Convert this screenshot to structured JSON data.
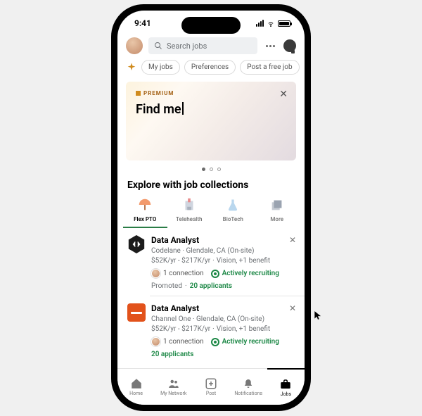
{
  "statusbar": {
    "time": "9:41"
  },
  "topbar": {
    "search_placeholder": "Search jobs"
  },
  "chips_row": {
    "items": [
      {
        "label": "My jobs"
      },
      {
        "label": "Preferences"
      },
      {
        "label": "Post a free job"
      }
    ]
  },
  "banner": {
    "badge": "PREMIUM",
    "typed_text": "Find me"
  },
  "explore": {
    "heading": "Explore with job collections",
    "categories": [
      {
        "label": "Flex PTO",
        "icon": "umbrella-icon",
        "active": true
      },
      {
        "label": "Telehealth",
        "icon": "hospital-icon",
        "active": false
      },
      {
        "label": "BioTech",
        "icon": "flask-icon",
        "active": false
      },
      {
        "label": "More",
        "icon": "stack-icon",
        "active": false
      }
    ]
  },
  "jobs": [
    {
      "title": "Data Analyst",
      "company": "Codelane",
      "location": "Glendale, CA (On-site)",
      "salary": "$52K/yr - $217K/yr",
      "benefit": "Vision, +1 benefit",
      "connection": "1 connection",
      "status": "Actively recruiting",
      "promoted": "Promoted",
      "applicants": "20 applicants"
    },
    {
      "title": "Data Analyst",
      "company": "Channel One",
      "location": "Glendale, CA (On-site)",
      "salary": "$52K/yr - $217K/yr",
      "benefit": "Vision, +1 benefit",
      "connection": "1 connection",
      "status": "Actively recruiting",
      "promoted": "",
      "applicants": "20 applicants"
    }
  ],
  "bottomnav": {
    "items": [
      {
        "label": "Home",
        "icon": "home-icon"
      },
      {
        "label": "My Network",
        "icon": "people-icon"
      },
      {
        "label": "Post",
        "icon": "plus-square-icon"
      },
      {
        "label": "Notifications",
        "icon": "bell-icon"
      },
      {
        "label": "Jobs",
        "icon": "briefcase-icon"
      }
    ],
    "active_index": 4
  }
}
